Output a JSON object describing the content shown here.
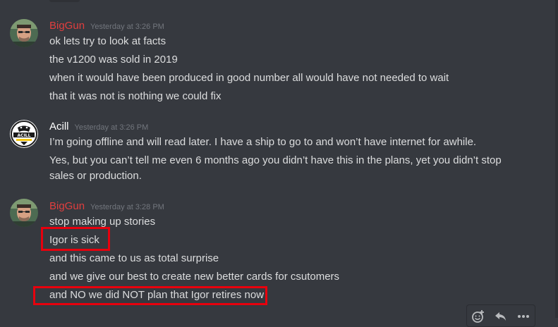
{
  "messages": [
    {
      "author": "BigGun",
      "author_color": "#e03e3e",
      "timestamp": "Yesterday at 3:26 PM",
      "avatar": "person-avatar",
      "lines": [
        "ok lets try to look at facts",
        "the v1200 was sold in 2019",
        "when it would have been produced in good number all would have not needed to wait",
        "that it was not is nothing we could fix"
      ]
    },
    {
      "author": "Acill",
      "author_color": "#ffffff",
      "timestamp": "Yesterday at 3:26 PM",
      "avatar": "gamepad-logo-avatar",
      "lines": [
        "I’m going offline and will read later. I have a ship to go to and won’t have internet for awhile.",
        "Yes, but you can’t tell me even 6 months ago you didn’t have this in the plans, yet you didn’t stop sales or production."
      ]
    },
    {
      "author": "BigGun",
      "author_color": "#e03e3e",
      "timestamp": "Yesterday at 3:28 PM",
      "avatar": "person-avatar",
      "lines": [
        "stop making up stories",
        "Igor is sick",
        "and this came to us as total surprise",
        "and we give our best to create new better cards for csutomers",
        "and NO we did NOT plan that Igor retires now"
      ]
    }
  ],
  "avatar_label": "ACILL",
  "action_icons": [
    "add-reaction-icon",
    "reply-icon",
    "more-options-icon"
  ],
  "highlight_color": "#e8000d"
}
